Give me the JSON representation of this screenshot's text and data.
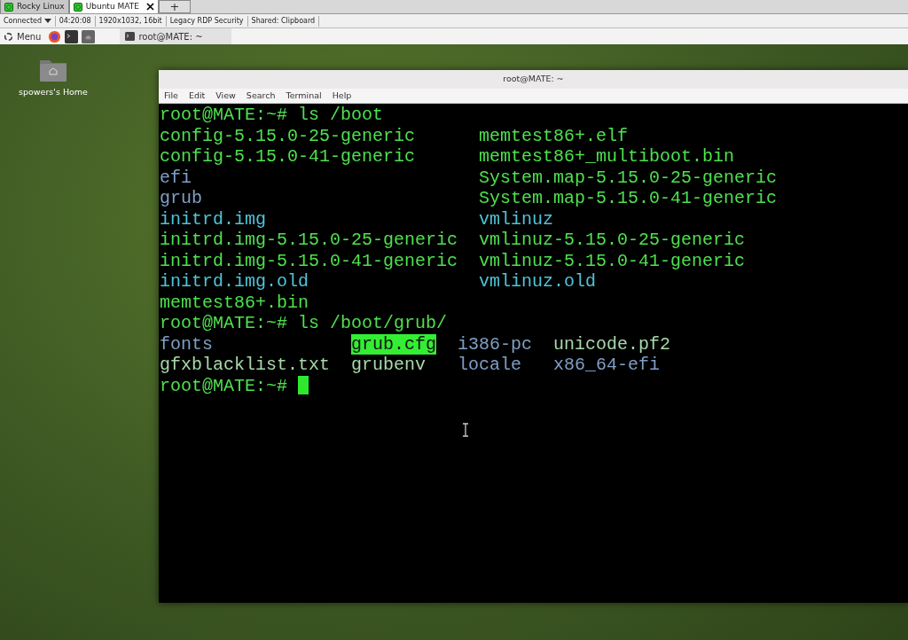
{
  "client_tabs": [
    {
      "label": "Rocky Linux",
      "selected": false,
      "closable": false
    },
    {
      "label": "Ubuntu MATE",
      "selected": true,
      "closable": true
    }
  ],
  "new_tab": {
    "label": "+"
  },
  "status_bar": [
    "Connected",
    "04:20:08",
    "1920x1032, 16bit",
    "Legacy RDP Security",
    "Shared: Clipboard"
  ],
  "panel": {
    "menu_label": "Menu",
    "tasks": [
      {
        "label": "root@MATE: ~"
      }
    ]
  },
  "desktop_icons": [
    {
      "label": "spowers's Home"
    }
  ],
  "window": {
    "title": "root@MATE: ~",
    "menu": [
      "File",
      "Edit",
      "View",
      "Search",
      "Terminal",
      "Help"
    ]
  },
  "terminal": {
    "lines": [
      {
        "kind": "prompt",
        "text": "root@MATE:~# ls /boot"
      },
      {
        "kind": "listing",
        "rows": [
          [
            {
              "text": "config-5.15.0-25-generic",
              "kind": "file"
            },
            {
              "text": "memtest86+.elf",
              "kind": "file"
            }
          ],
          [
            {
              "text": "config-5.15.0-41-generic",
              "kind": "file"
            },
            {
              "text": "memtest86+_multiboot.bin",
              "kind": "file"
            }
          ],
          [
            {
              "text": "efi",
              "kind": "dir"
            },
            {
              "text": "System.map-5.15.0-25-generic",
              "kind": "file"
            }
          ],
          [
            {
              "text": "grub",
              "kind": "dir"
            },
            {
              "text": "System.map-5.15.0-41-generic",
              "kind": "file"
            }
          ],
          [
            {
              "text": "initrd.img",
              "kind": "link"
            },
            {
              "text": "vmlinuz",
              "kind": "link"
            }
          ],
          [
            {
              "text": "initrd.img-5.15.0-25-generic",
              "kind": "file"
            },
            {
              "text": "vmlinuz-5.15.0-25-generic",
              "kind": "file"
            }
          ],
          [
            {
              "text": "initrd.img-5.15.0-41-generic",
              "kind": "file"
            },
            {
              "text": "vmlinuz-5.15.0-41-generic",
              "kind": "file"
            }
          ],
          [
            {
              "text": "initrd.img.old",
              "kind": "link"
            },
            {
              "text": "vmlinuz.old",
              "kind": "link"
            }
          ],
          [
            {
              "text": "memtest86+.bin",
              "kind": "file"
            }
          ]
        ]
      },
      {
        "kind": "prompt",
        "text": "root@MATE:~# ls /boot/grub/"
      },
      {
        "kind": "listing",
        "rows": [
          [
            {
              "text": "fonts",
              "kind": "dir"
            },
            {
              "text": "grub.cfg",
              "kind": "highlight"
            },
            {
              "text": "i386-pc",
              "kind": "dir"
            },
            {
              "text": "unicode.pf2",
              "kind": "plain"
            }
          ],
          [
            {
              "text": "gfxblacklist.txt",
              "kind": "plain"
            },
            {
              "text": "grubenv",
              "kind": "plain"
            },
            {
              "text": "locale",
              "kind": "dir"
            },
            {
              "text": "x86_64-efi",
              "kind": "dir"
            }
          ]
        ]
      },
      {
        "kind": "prompt",
        "text": "root@MATE:~#",
        "cursor": true
      }
    ]
  }
}
